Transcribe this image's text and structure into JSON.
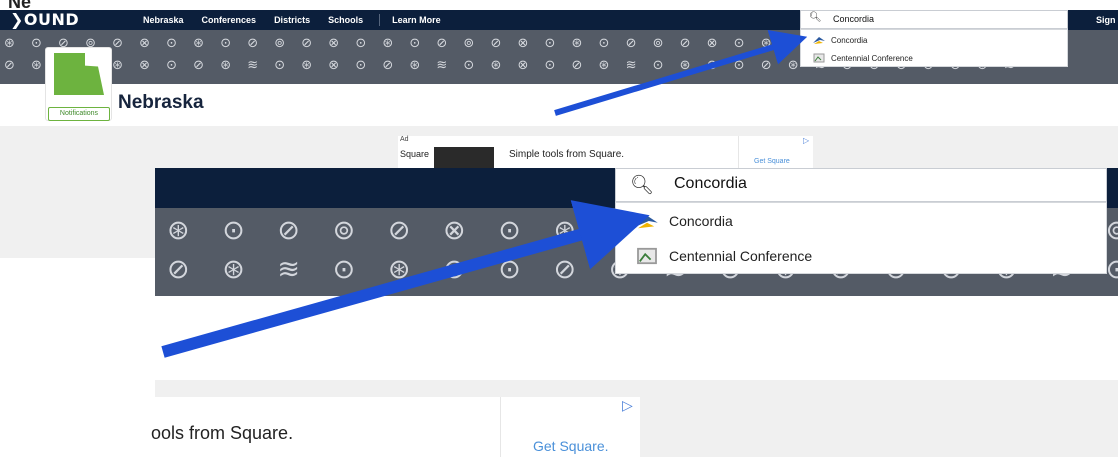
{
  "header_text": "Ne",
  "brand": "❯OUND",
  "nav": [
    "Nebraska",
    "Conferences",
    "Districts",
    "Schools"
  ],
  "learn_more": "Learn More",
  "sign_in": "Sign In",
  "state_title": "Nebraska",
  "notifications_label": "Notifications",
  "search": {
    "value": "Concordia",
    "results": [
      "Concordia",
      "Centennial Conference"
    ]
  },
  "ad": {
    "label": "Ad",
    "brand": "Square",
    "text": "Simple tools from Square.",
    "cta": "Get Square",
    "cta_zoom": "Get Square.",
    "text_zoom": "ools from Square."
  },
  "icons": {
    "search": "search-icon",
    "arrow": "arrow-annotation"
  },
  "colors": {
    "nav_bg": "#0c1f3c",
    "pattern_bg": "#545b66",
    "accent": "#6db33f",
    "arrow": "#1d4fd6"
  }
}
